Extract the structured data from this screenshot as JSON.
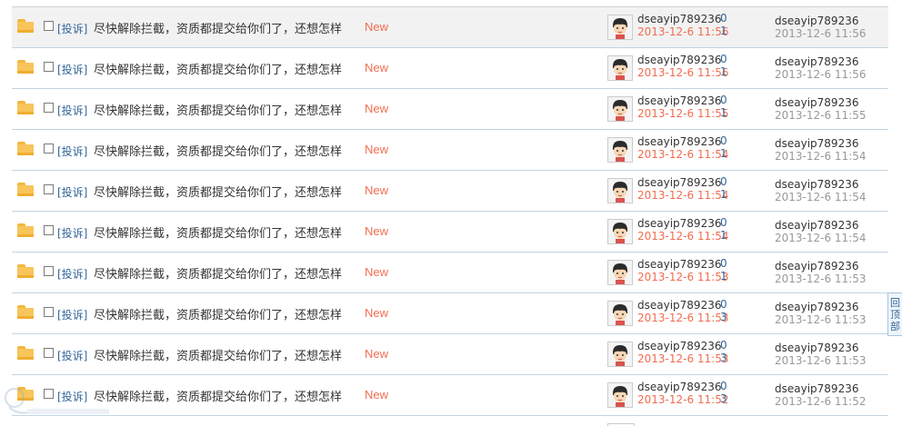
{
  "colors": {
    "new": "#f26c4f",
    "link": "#336699",
    "divider": "#c2d5e3"
  },
  "icons": {
    "folder": "folder-icon",
    "avatar": "avatar-icon"
  },
  "back_to_top": "回\n顶\n部",
  "rows": [
    {
      "tag": "[投诉]",
      "title": "尽快解除拦截，资质都提交给你们了，还想怎样",
      "badge": "New",
      "author": "dseayip789236",
      "time": "2013-12-6 11:56",
      "replies": "0",
      "views": "1",
      "last_author": "dseayip789236",
      "last_time": "2013-12-6 11:56"
    },
    {
      "tag": "[投诉]",
      "title": "尽快解除拦截，资质都提交给你们了，还想怎样",
      "badge": "New",
      "author": "dseayip789236",
      "time": "2013-12-6 11:56",
      "replies": "0",
      "views": "1",
      "last_author": "dseayip789236",
      "last_time": "2013-12-6 11:56"
    },
    {
      "tag": "[投诉]",
      "title": "尽快解除拦截，资质都提交给你们了，还想怎样",
      "badge": "New",
      "author": "dseayip789236",
      "time": "2013-12-6 11:55",
      "replies": "0",
      "views": "1",
      "last_author": "dseayip789236",
      "last_time": "2013-12-6 11:55"
    },
    {
      "tag": "[投诉]",
      "title": "尽快解除拦截，资质都提交给你们了，还想怎样",
      "badge": "New",
      "author": "dseayip789236",
      "time": "2013-12-6 11:54",
      "replies": "0",
      "views": "1",
      "last_author": "dseayip789236",
      "last_time": "2013-12-6 11:54"
    },
    {
      "tag": "[投诉]",
      "title": "尽快解除拦截，资质都提交给你们了，还想怎样",
      "badge": "New",
      "author": "dseayip789236",
      "time": "2013-12-6 11:54",
      "replies": "0",
      "views": "1",
      "last_author": "dseayip789236",
      "last_time": "2013-12-6 11:54"
    },
    {
      "tag": "[投诉]",
      "title": "尽快解除拦截，资质都提交给你们了，还想怎样",
      "badge": "New",
      "author": "dseayip789236",
      "time": "2013-12-6 11:54",
      "replies": "0",
      "views": "1",
      "last_author": "dseayip789236",
      "last_time": "2013-12-6 11:54"
    },
    {
      "tag": "[投诉]",
      "title": "尽快解除拦截，资质都提交给你们了，还想怎样",
      "badge": "New",
      "author": "dseayip789236",
      "time": "2013-12-6 11:53",
      "replies": "0",
      "views": "1",
      "last_author": "dseayip789236",
      "last_time": "2013-12-6 11:53"
    },
    {
      "tag": "[投诉]",
      "title": "尽快解除拦截，资质都提交给你们了，还想怎样",
      "badge": "New",
      "author": "dseayip789236",
      "time": "2013-12-6 11:53",
      "replies": "0",
      "views": "3",
      "last_author": "dseayip789236",
      "last_time": "2013-12-6 11:53"
    },
    {
      "tag": "[投诉]",
      "title": "尽快解除拦截，资质都提交给你们了，还想怎样",
      "badge": "New",
      "author": "dseayip789236",
      "time": "2013-12-6 11:53",
      "replies": "0",
      "views": "3",
      "last_author": "dseayip789236",
      "last_time": "2013-12-6 11:53"
    },
    {
      "tag": "[投诉]",
      "title": "尽快解除拦截，资质都提交给你们了，还想怎样",
      "badge": "New",
      "author": "dseayip789236",
      "time": "2013-12-6 11:52",
      "replies": "0",
      "views": "3",
      "last_author": "dseayip789236",
      "last_time": "2013-12-6 11:52"
    }
  ]
}
